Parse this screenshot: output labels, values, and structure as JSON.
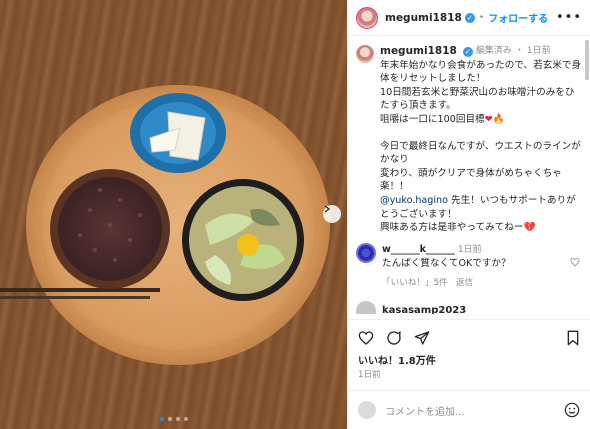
{
  "post": {
    "username": "megumi1818",
    "follow_label": "フォローする",
    "more_label": "•••"
  },
  "caption": {
    "username": "megumi1818",
    "edited": "編集済み",
    "dot": "・",
    "time": "1日前",
    "line1": "年末年始かなり会食があったので、若玄米で身体をリセットしました！",
    "line2": "10日間若玄米と野菜沢山のお味噌汁のみをひたすら頂きます。",
    "line3": "咀嚼は一口に100回目標",
    "line4": "今日で最終日なんですが、ウエストのラインがかなり",
    "line5": "変わり、頭がクリアで身体がめちゃくちゃ楽！！",
    "mention": "@yuko.hagino",
    "line6": " 先生！いつもサポートありがとうございます！",
    "line7": "興味ある方は是非やってみてねー"
  },
  "comment": {
    "username": "w______k______",
    "time": "1日前",
    "text": "たんぱく質なくてOKですか？",
    "likes": "「いいね！」5件",
    "reply": "返信"
  },
  "next_comment_user": "kasasamp2023",
  "likes_label": "いいね！1.8万件",
  "post_date": "1日前",
  "comment_placeholder": "コメントを追加...",
  "carousel": {
    "total": 4,
    "active": 1
  },
  "colors": {
    "accent": "#0095f6",
    "verified": "#3897f0",
    "heart": "#e0263c"
  }
}
